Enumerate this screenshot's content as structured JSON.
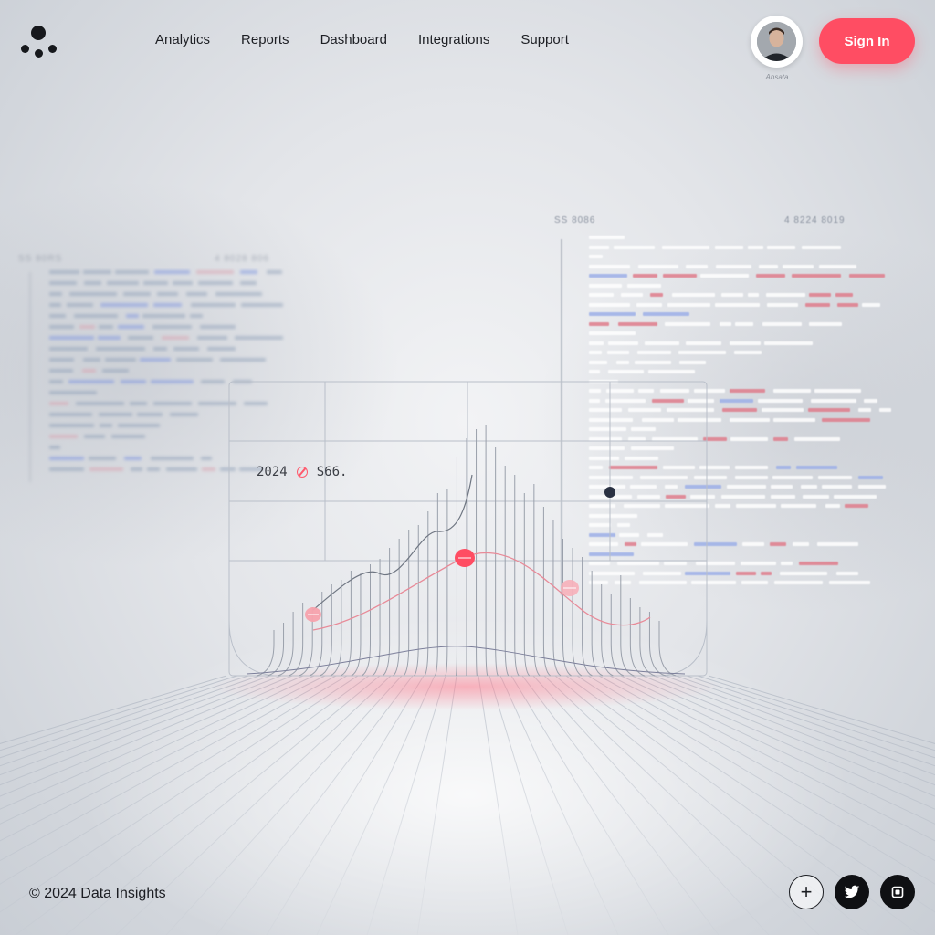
{
  "header": {
    "logo_icon": "dots-logo-icon",
    "nav": [
      "Analytics",
      "Reports",
      "Dashboard",
      "Integrations",
      "Support"
    ],
    "avatar_caption": "Ansata",
    "signin_label": "Sign In"
  },
  "panels": {
    "left_header": "SS 80RS",
    "left_header_right": "4 8028 806",
    "right_header": "SS 8086",
    "right_header_right": "4 8224 8019"
  },
  "chart": {
    "label_year": "2024",
    "label_value": "S66."
  },
  "colors": {
    "accent": "#ff4d63",
    "marker_dark": "#2a3142",
    "text": "#1b1d22"
  },
  "footer": {
    "copyright": "© 2024 Data Insights",
    "buttons": [
      "plus-icon",
      "twitter-icon",
      "square-icon"
    ]
  }
}
